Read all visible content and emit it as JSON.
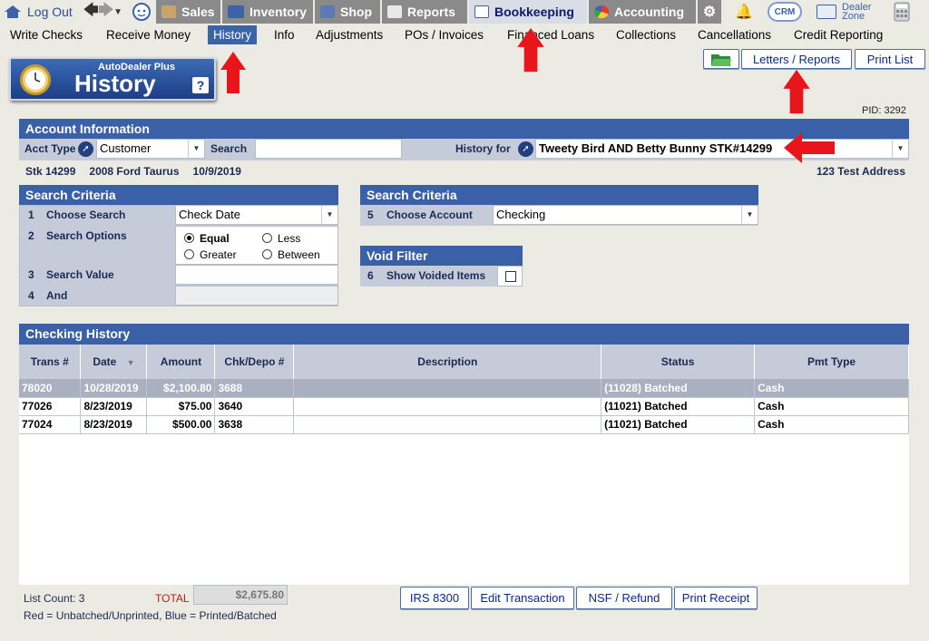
{
  "topnav": {
    "logout": "Log Out",
    "sales": "Sales",
    "inventory": "Inventory",
    "shop": "Shop",
    "reports": "Reports",
    "bookkeeping": "Bookkeeping",
    "accounting": "Accounting",
    "crm": "CRM",
    "dealer_zone_1": "Dealer",
    "dealer_zone_2": "Zone"
  },
  "subnav": [
    "Write Checks",
    "Receive Money",
    "History",
    "Info",
    "Adjustments",
    "POs / Invoices",
    "Financed Loans",
    "Collections",
    "Cancellations",
    "Credit Reporting"
  ],
  "logo": {
    "brand": "AutoDealer Plus",
    "title": "History",
    "help": "?"
  },
  "buttons": {
    "letters": "Letters / Reports",
    "print_list": "Print List",
    "irs": "IRS 8300",
    "edit": "Edit Transaction",
    "nsf": "NSF / Refund",
    "print_receipt": "Print Receipt"
  },
  "pid": "PID: 3292",
  "account": {
    "heading": "Account Information",
    "acct_type_label": "Acct Type",
    "acct_type": "Customer",
    "search_label": "Search",
    "search_value": "",
    "history_for_label": "History for",
    "history_for": "Tweety Bird AND Betty Bunny STK#14299",
    "stk": "Stk 14299",
    "vehicle": "2008 Ford Taurus",
    "date": "10/9/2019",
    "address": "123 Test Address"
  },
  "criteria": {
    "heading": "Search Criteria",
    "rows": [
      {
        "n": "1",
        "label": "Choose Search",
        "value": "Check Date"
      },
      {
        "n": "2",
        "label": "Search Options"
      },
      {
        "n": "3",
        "label": "Search Value",
        "value": ""
      },
      {
        "n": "4",
        "label": "And",
        "value": ""
      }
    ],
    "options": {
      "equal": "Equal",
      "less": "Less",
      "greater": "Greater",
      "between": "Between"
    }
  },
  "criteria2": {
    "heading": "Search Criteria",
    "n": "5",
    "label": "Choose Account",
    "value": "Checking"
  },
  "void": {
    "heading": "Void Filter",
    "n": "6",
    "label": "Show Voided Items"
  },
  "history": {
    "heading": "Checking History",
    "cols": [
      "Trans #",
      "Date",
      "Amount",
      "Chk/Depo #",
      "Description",
      "Status",
      "Pmt Type"
    ],
    "rows": [
      {
        "trans": "78020",
        "date": "10/28/2019",
        "amount": "$2,100.80",
        "chk": "3688",
        "desc": "",
        "status": "(11028) Batched",
        "pmt": "Cash"
      },
      {
        "trans": "77026",
        "date": "8/23/2019",
        "amount": "$75.00",
        "chk": "3640",
        "desc": "",
        "status": "(11021) Batched",
        "pmt": "Cash"
      },
      {
        "trans": "77024",
        "date": "8/23/2019",
        "amount": "$500.00",
        "chk": "3638",
        "desc": "",
        "status": "(11021) Batched",
        "pmt": "Cash"
      }
    ]
  },
  "footer": {
    "list_count": "List Count: 3",
    "total_label": "TOTAL",
    "total": "$2,675.80",
    "legend": "Red = Unbatched/Unprinted, Blue = Printed/Batched"
  }
}
